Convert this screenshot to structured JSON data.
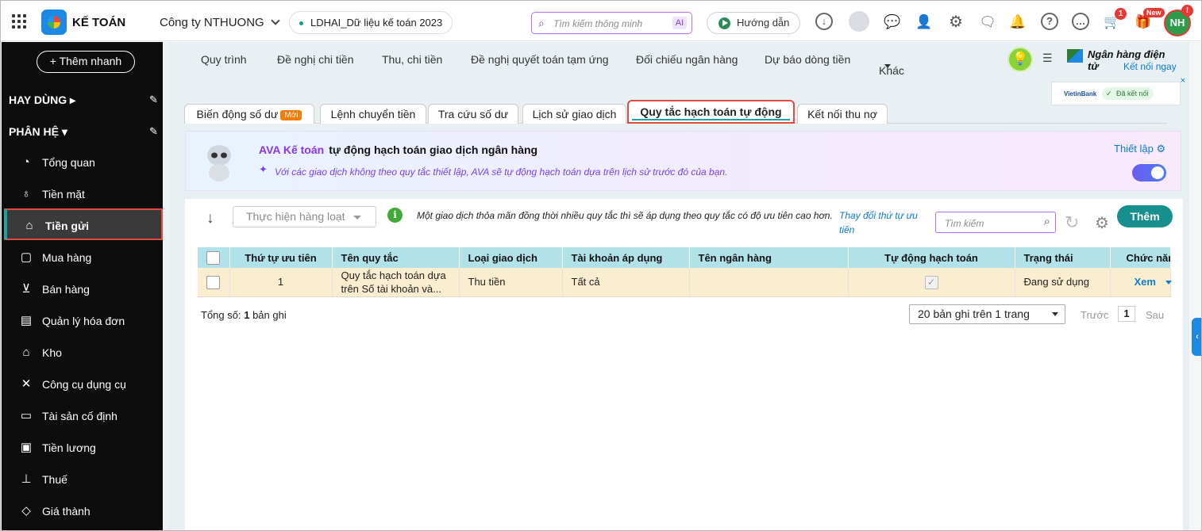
{
  "header": {
    "brand": "KẾ TOÁN",
    "company": "Công ty NTHUONG",
    "dataset": "LDHAI_Dữ liệu kế toán 2023",
    "smart_search_placeholder": "Tìm kiếm thông minh",
    "ai_label": "AI",
    "guide_label": "Hướng dẫn",
    "cart_badge": "1",
    "new_badge": "New",
    "avatar_initials": "NH",
    "avatar_badge": "!"
  },
  "sidebar": {
    "quick_add": "+ Thêm nhanh",
    "favorites_label": "HAY DÙNG",
    "modules_label": "PHÂN HỆ",
    "items": [
      {
        "label": "Tổng quan",
        "icon": "pie-chart-icon"
      },
      {
        "label": "Tiền mặt",
        "icon": "money-bag-icon"
      },
      {
        "label": "Tiền gửi",
        "icon": "bank-icon"
      },
      {
        "label": "Mua hàng",
        "icon": "shopping-bag-icon"
      },
      {
        "label": "Bán hàng",
        "icon": "cart-icon"
      },
      {
        "label": "Quản lý hóa đơn",
        "icon": "invoice-icon"
      },
      {
        "label": "Kho",
        "icon": "warehouse-icon"
      },
      {
        "label": "Công cụ dụng cụ",
        "icon": "tools-icon"
      },
      {
        "label": "Tài sản cố định",
        "icon": "car-icon"
      },
      {
        "label": "Tiền lương",
        "icon": "salary-icon"
      },
      {
        "label": "Thuế",
        "icon": "tax-icon"
      },
      {
        "label": "Giá thành",
        "icon": "price-tag-icon"
      }
    ]
  },
  "nav": {
    "items": [
      "Quy trình",
      "Đề nghị chi tiền",
      "Thu, chi tiền",
      "Đề nghị quyết toán tạm ứng",
      "Đối chiếu ngân hàng",
      "Dự báo dòng tiền",
      "Khác"
    ],
    "ebank_title": "Ngân hàng điện tử",
    "ebank_link": "Kết nối ngay",
    "bank_name": "VietinBank",
    "bank_status": "Đã kết nối"
  },
  "tabs": {
    "items": [
      "Biến động số dư",
      "Lệnh chuyển tiền",
      "Tra cứu số dư",
      "Lịch sử giao dịch",
      "Quy tắc hạch toán tự động",
      "Kết nối thu nợ"
    ],
    "new_badge": "Mới",
    "active": "Quy tắc hạch toán tự động"
  },
  "ava": {
    "name": "AVA Kế toán",
    "title": "tự động hạch toán giao dịch ngân hàng",
    "subtitle": "Với các giao dịch không theo quy tắc thiết lập, AVA sẽ tự động hạch toán dựa trên lịch sử trước đó của bạn.",
    "setup": "Thiết lập",
    "toggle_on": true
  },
  "toolbar": {
    "bulk_action": "Thực hiện hàng loạt",
    "info": "Một giao dịch thỏa mãn đồng thời nhiều quy tắc thì sẽ áp dụng theo quy tắc có độ ưu tiên cao hơn.",
    "change_priority": "Thay đổi thứ tự ưu tiên",
    "search_placeholder": "Tìm kiếm",
    "add": "Thêm"
  },
  "table": {
    "headers": [
      "Thứ tự ưu tiên",
      "Tên quy tắc",
      "Loại giao dịch",
      "Tài khoản áp dụng",
      "Tên ngân hàng",
      "Tự động hạch toán",
      "Trạng thái",
      "Chức năng"
    ],
    "rows": [
      {
        "priority": "1",
        "name": "Quy tắc hạch toán dựa trên Số tài khoản và...",
        "type": "Thu tiền",
        "account": "Tất cả",
        "bank": "",
        "auto": true,
        "status": "Đang sử dụng",
        "action": "Xem"
      }
    ]
  },
  "footer": {
    "total_prefix": "Tổng số:",
    "total_count": "1",
    "total_suffix": "bản ghi",
    "page_size": "20 bản ghi trên 1 trang",
    "prev": "Trước",
    "page": "1",
    "next": "Sau"
  }
}
